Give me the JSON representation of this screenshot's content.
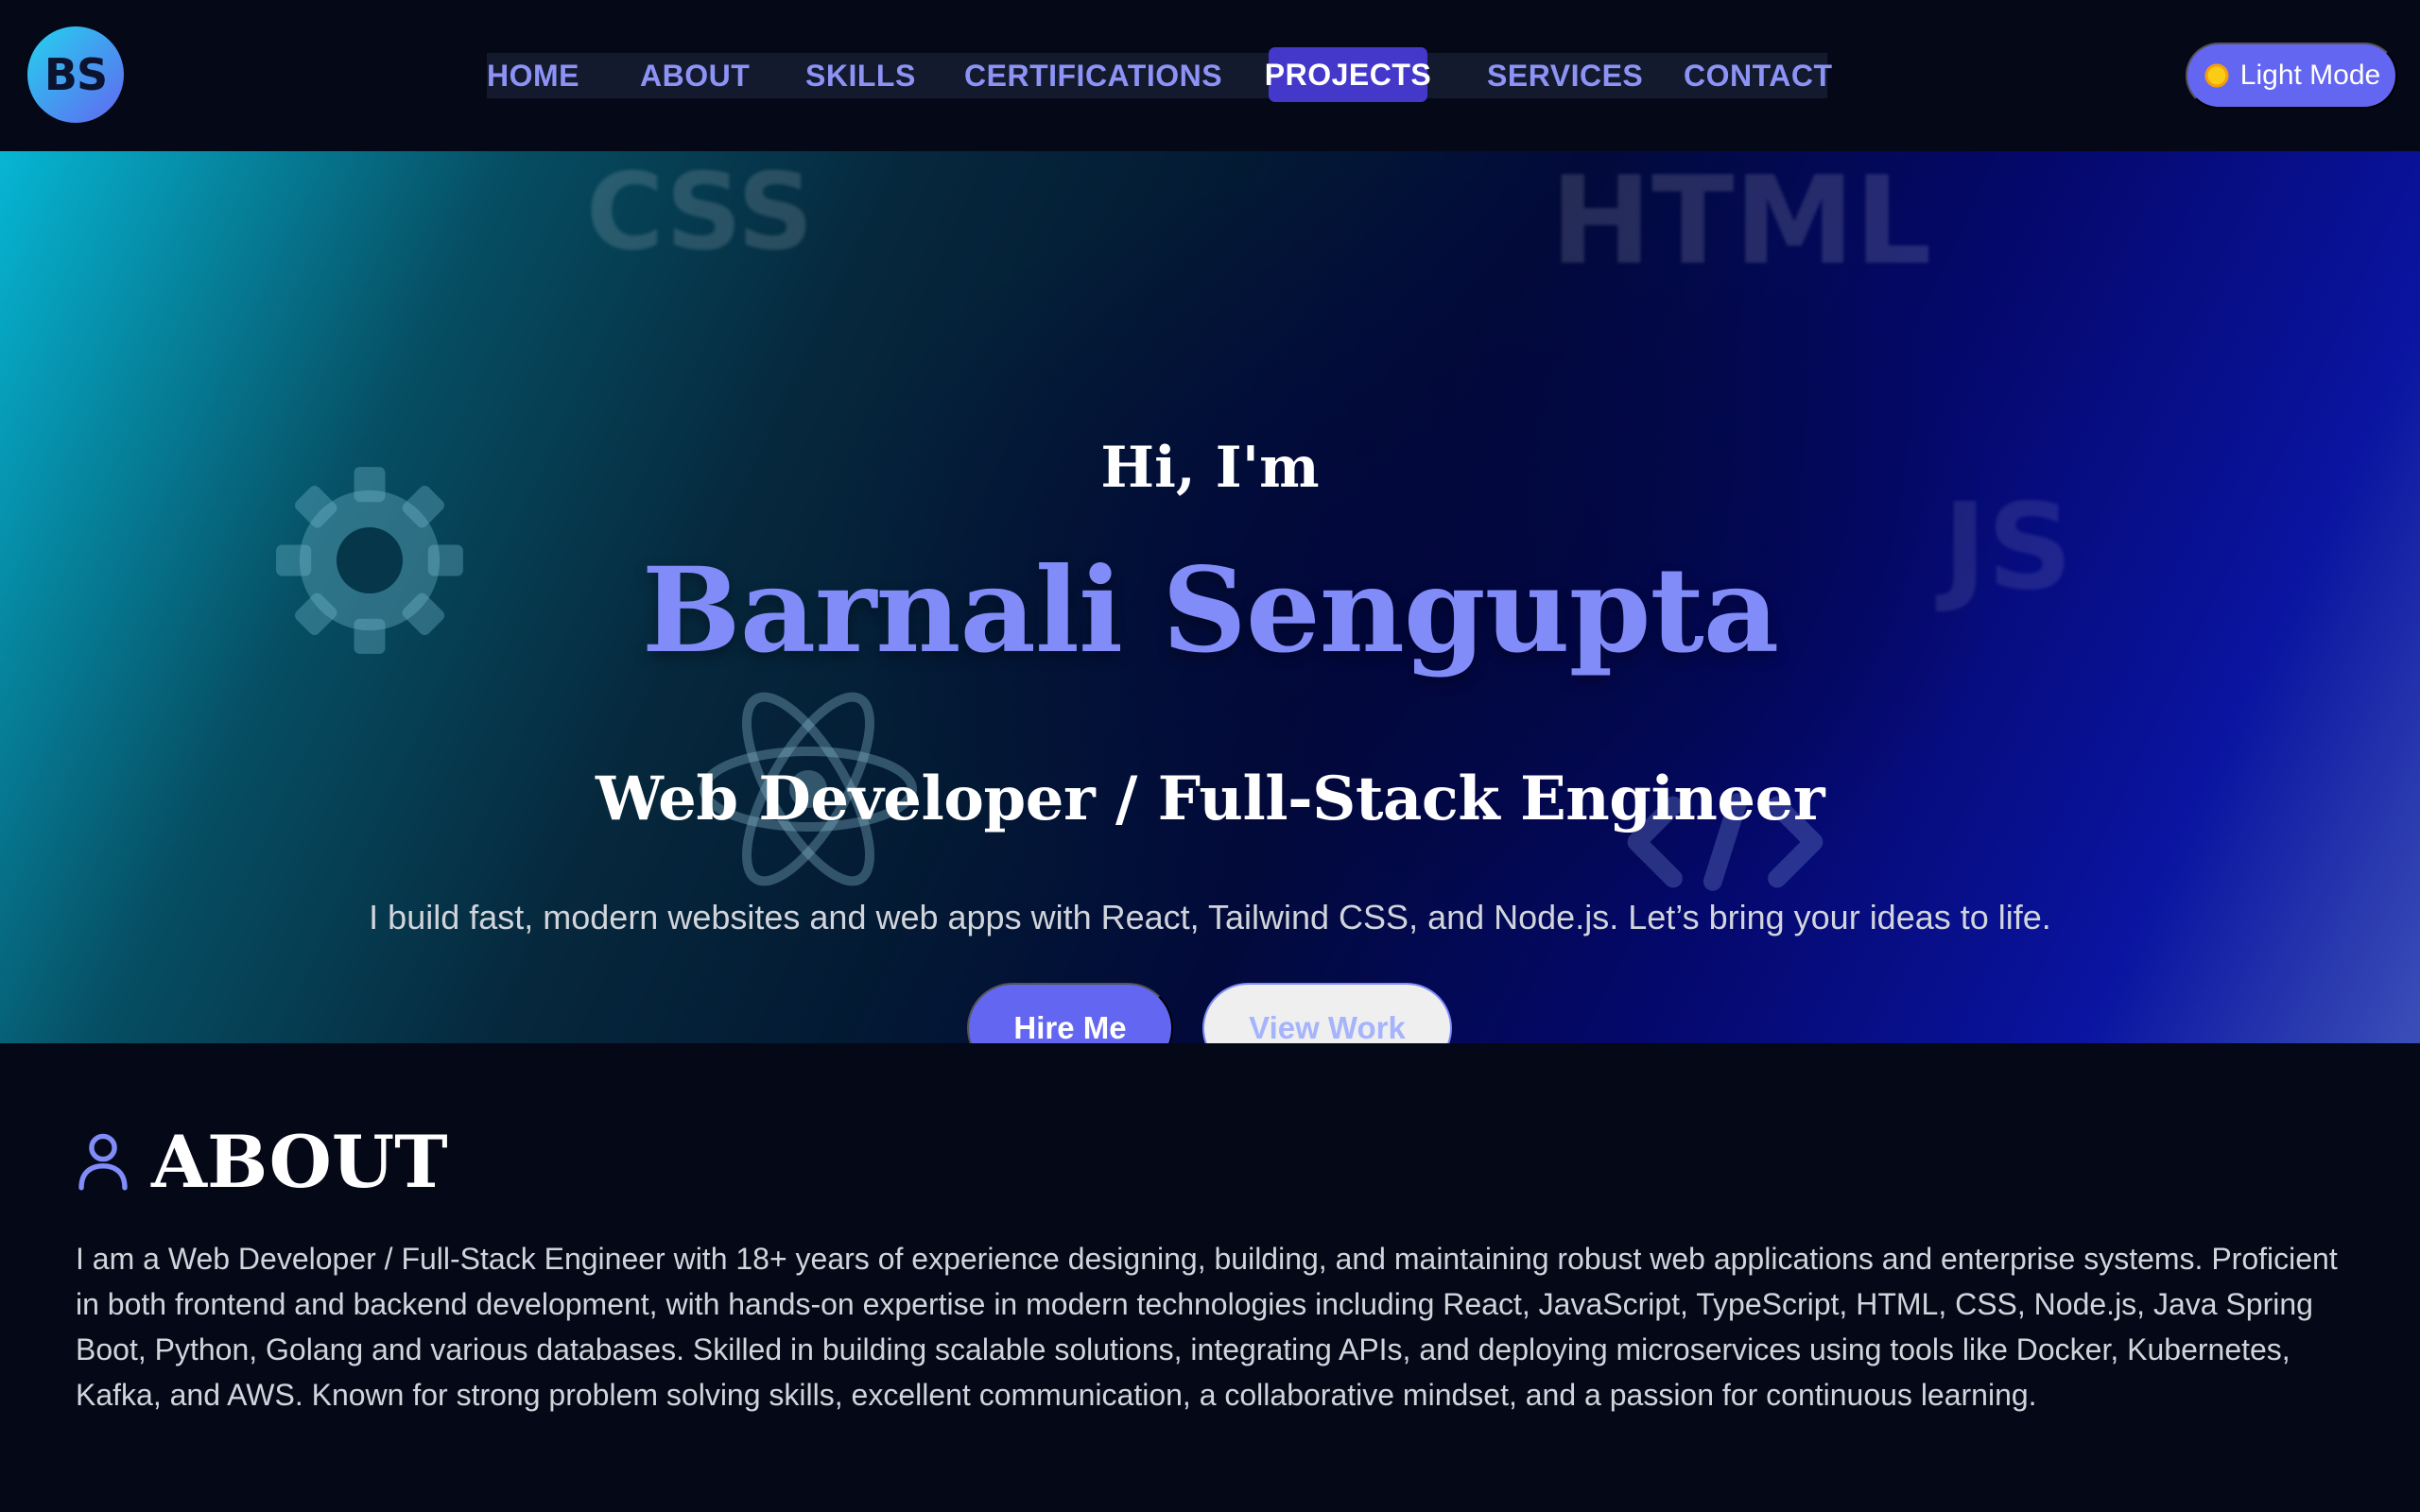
{
  "brand": {
    "logo_text": "BS"
  },
  "nav": {
    "items": [
      {
        "label": "HOME"
      },
      {
        "label": "ABOUT"
      },
      {
        "label": "SKILLS"
      },
      {
        "label": "CERTIFICATIONS"
      },
      {
        "label": "PROJECTS",
        "active": true
      },
      {
        "label": "SERVICES"
      },
      {
        "label": "CONTACT"
      }
    ],
    "theme_toggle_label": "Light Mode"
  },
  "hero": {
    "greeting": "Hi, I'm",
    "name": "Barnali Sengupta",
    "role": "Web Developer / Full-Stack Engineer",
    "tagline": "I build fast, modern websites and web apps with React, Tailwind CSS, and Node.js. Let’s bring your ideas to life.",
    "primary_cta": "Hire Me",
    "secondary_cta": "View Work",
    "background_words": [
      "CSS",
      "HTML",
      "JS"
    ]
  },
  "about": {
    "title": "ABOUT",
    "paragraph": "I am a Web Developer / Full-Stack Engineer with 18+ years of experience designing, building, and maintaining robust web applications and enterprise systems. Proficient in both frontend and backend development, with hands-on expertise in modern technologies including React, JavaScript, TypeScript, HTML, CSS, Node.js, Java Spring Boot, Python, Golang and various databases. Skilled in building scalable solutions, integrating APIs, and deploying microservices using tools like Docker, Kubernetes, Kafka, and AWS. Known for strong problem solving skills, excellent communication, a collaborative mindset, and a passion for continuous learning."
  },
  "colors": {
    "page_bg": "#050817",
    "accent": "#6366f1",
    "accent_light": "#818cf8",
    "nav_active_bg": "#4338ca",
    "hero_gradient_start": "#06b6d4",
    "hero_gradient_end": "#3b4fb8"
  },
  "icons": [
    "gear-icon",
    "atom-icon",
    "code-brackets-icon",
    "sun-icon",
    "user-icon"
  ]
}
